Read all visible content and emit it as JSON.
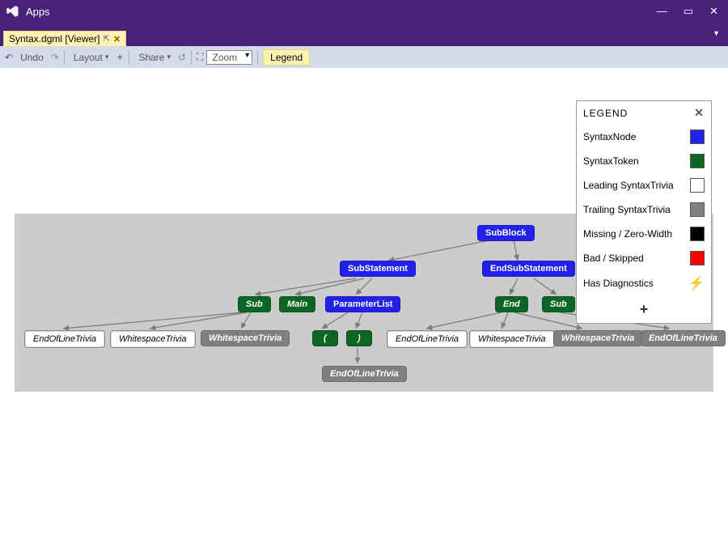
{
  "window": {
    "title": "Apps"
  },
  "tab": {
    "label": "Syntax.dgml [Viewer]"
  },
  "toolbar": {
    "undo": "Undo",
    "layout": "Layout",
    "share": "Share",
    "zoom_label": "Zoom",
    "legend_label": "Legend"
  },
  "legend": {
    "title": "LEGEND",
    "items": [
      {
        "label": "SyntaxNode",
        "color": "#2121E7"
      },
      {
        "label": "SyntaxToken",
        "color": "#0B6623"
      },
      {
        "label": "Leading SyntaxTrivia",
        "color": "#FFFFFF"
      },
      {
        "label": "Trailing SyntaxTrivia",
        "color": "#808080"
      },
      {
        "label": "Missing / Zero-Width",
        "color": "#000000"
      },
      {
        "label": "Bad / Skipped",
        "color": "#FF0000"
      }
    ],
    "diag_label": "Has Diagnostics"
  },
  "chart_data": {
    "type": "tree",
    "title": "Syntax tree (DGML)",
    "nodes": [
      {
        "id": "subblock",
        "label": "SubBlock",
        "kind": "SyntaxNode"
      },
      {
        "id": "substmt",
        "label": "SubStatement",
        "kind": "SyntaxNode"
      },
      {
        "id": "endsubstmt",
        "label": "EndSubStatement",
        "kind": "SyntaxNode"
      },
      {
        "id": "sub1",
        "label": "Sub",
        "kind": "SyntaxToken"
      },
      {
        "id": "main",
        "label": "Main",
        "kind": "SyntaxToken"
      },
      {
        "id": "paramlist",
        "label": "ParameterList",
        "kind": "SyntaxNode"
      },
      {
        "id": "end",
        "label": "End",
        "kind": "SyntaxToken"
      },
      {
        "id": "sub2",
        "label": "Sub",
        "kind": "SyntaxToken"
      },
      {
        "id": "eol1",
        "label": "EndOfLineTrivia",
        "kind": "LeadingSyntaxTrivia"
      },
      {
        "id": "ws1",
        "label": "WhitespaceTrivia",
        "kind": "LeadingSyntaxTrivia"
      },
      {
        "id": "ws2",
        "label": "WhitespaceTrivia",
        "kind": "TrailingSyntaxTrivia"
      },
      {
        "id": "lparen",
        "label": "(",
        "kind": "SyntaxToken"
      },
      {
        "id": "rparen",
        "label": ")",
        "kind": "SyntaxToken"
      },
      {
        "id": "eol2",
        "label": "EndOfLineTrivia",
        "kind": "LeadingSyntaxTrivia"
      },
      {
        "id": "ws3",
        "label": "WhitespaceTrivia",
        "kind": "LeadingSyntaxTrivia"
      },
      {
        "id": "ws4",
        "label": "WhitespaceTrivia",
        "kind": "TrailingSyntaxTrivia"
      },
      {
        "id": "eol3",
        "label": "EndOfLineTrivia",
        "kind": "TrailingSyntaxTrivia"
      },
      {
        "id": "eol4",
        "label": "EndOfLineTrivia",
        "kind": "TrailingSyntaxTrivia"
      }
    ],
    "edges": [
      [
        "subblock",
        "substmt"
      ],
      [
        "subblock",
        "endsubstmt"
      ],
      [
        "substmt",
        "sub1"
      ],
      [
        "substmt",
        "main"
      ],
      [
        "substmt",
        "paramlist"
      ],
      [
        "sub1",
        "eol1"
      ],
      [
        "sub1",
        "ws1"
      ],
      [
        "sub1",
        "ws2"
      ],
      [
        "paramlist",
        "lparen"
      ],
      [
        "paramlist",
        "rparen"
      ],
      [
        "rparen",
        "eol4"
      ],
      [
        "endsubstmt",
        "end"
      ],
      [
        "endsubstmt",
        "sub2"
      ],
      [
        "end",
        "eol2"
      ],
      [
        "end",
        "ws3"
      ],
      [
        "end",
        "ws4"
      ],
      [
        "sub2",
        "eol3"
      ]
    ]
  }
}
